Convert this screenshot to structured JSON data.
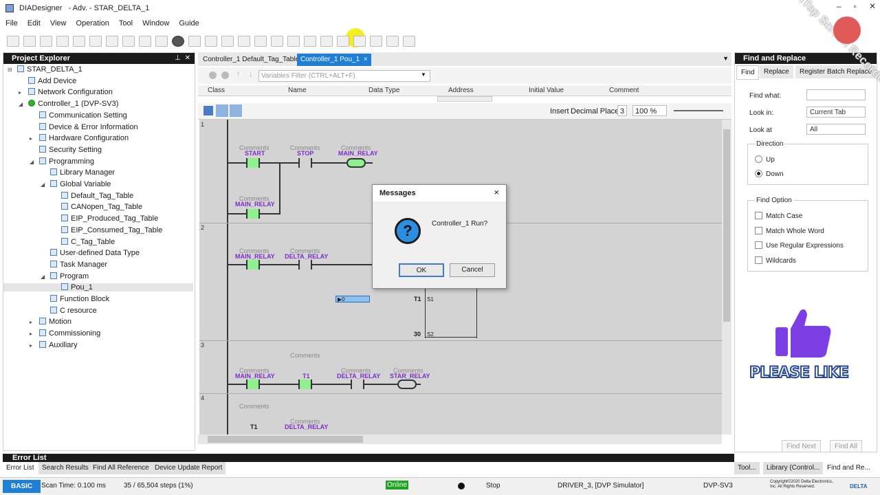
{
  "app": {
    "title": "DIADesigner",
    "subtitle": "- Adv. - STAR_DELTA_1"
  },
  "menu": [
    "File",
    "Edit",
    "View",
    "Operation",
    "Tool",
    "Window",
    "Guide"
  ],
  "explorer": {
    "title": "Project Explorer",
    "items": [
      {
        "label": "STAR_DELTA_1",
        "exp": "⊟"
      },
      {
        "label": "Add Device",
        "exp": ""
      },
      {
        "label": "Network Configuration",
        "exp": "▸"
      },
      {
        "label": "Controller_1 (DVP-SV3)",
        "exp": "◢"
      },
      {
        "label": "Communication Setting",
        "exp": ""
      },
      {
        "label": "Device & Error Information",
        "exp": ""
      },
      {
        "label": "Hardware Configuration",
        "exp": "▸"
      },
      {
        "label": "Security Setting",
        "exp": ""
      },
      {
        "label": "Programming",
        "exp": "◢"
      },
      {
        "label": "Library Manager",
        "exp": ""
      },
      {
        "label": "Global Variable",
        "exp": "◢"
      },
      {
        "label": "Default_Tag_Table",
        "exp": ""
      },
      {
        "label": "CANopen_Tag_Table",
        "exp": ""
      },
      {
        "label": "EIP_Produced_Tag_Table",
        "exp": ""
      },
      {
        "label": "EIP_Consumed_Tag_Table",
        "exp": ""
      },
      {
        "label": "C_Tag_Table",
        "exp": ""
      },
      {
        "label": "User-defined Data Type",
        "exp": ""
      },
      {
        "label": "Task Manager",
        "exp": ""
      },
      {
        "label": "Program",
        "exp": "◢"
      },
      {
        "label": "Pou_1",
        "exp": ""
      },
      {
        "label": "Function Block",
        "exp": ""
      },
      {
        "label": "C resource",
        "exp": ""
      },
      {
        "label": "Motion",
        "exp": "▸"
      },
      {
        "label": "Commissioning",
        "exp": "▸"
      },
      {
        "label": "Auxiliary",
        "exp": "▸"
      }
    ]
  },
  "editor_tabs": [
    {
      "label": "Controller_1 Default_Tag_Table"
    },
    {
      "label": "Controller_1 Pou_1",
      "close": "×"
    }
  ],
  "vars": {
    "filter_placeholder": "Variables Filter (CTRL+ALT+F)",
    "columns": [
      "Class",
      "Name",
      "Data Type",
      "Address",
      "Initial Value",
      "Comment"
    ]
  },
  "ladder_toolbar": {
    "insert": "Insert",
    "decimal_label": "Decimal Place:",
    "decimal_value": "3",
    "zoom": "100 %"
  },
  "ladder": {
    "comment": "Comments",
    "r1": {
      "num": "1",
      "c1": "START",
      "c2": "STOP",
      "coil": "MAIN_RELAY",
      "c3": "MAIN_RELAY"
    },
    "r2": {
      "num": "2",
      "c1": "MAIN_RELAY",
      "c2": "DELTA_RELAY",
      "input": "▶0",
      "t1": "T1",
      "s1": "S1",
      "t30": "30",
      "s2": "S2"
    },
    "r3": {
      "num": "3",
      "c1": "MAIN_RELAY",
      "c2": "T1",
      "c3": "DELTA_RELAY",
      "coil": "STAR_RELAY"
    },
    "r4": {
      "num": "4",
      "c1": "T1",
      "coil": "DELTA_RELAY"
    }
  },
  "dialog": {
    "title": "Messages",
    "close": "×",
    "message": "Controller_1 Run?",
    "ok": "OK",
    "cancel": "Cancel",
    "icon": "?"
  },
  "find": {
    "title": "Find and Replace",
    "tabs": [
      "Find",
      "Replace",
      "Register Batch Replace"
    ],
    "find_what": "Find what:",
    "look_in": "Look in:",
    "look_in_value": "Current Tab",
    "look_at": "Look at",
    "look_at_value": "All",
    "direction": "Direction",
    "up": "Up",
    "down": "Down",
    "find_option": "Find Option",
    "options": [
      "Match Case",
      "Match Whole Word",
      "Use Regular Expressions",
      "Wildcards"
    ],
    "find_next": "Find Next",
    "find_all": "Find All"
  },
  "error_list_title": "Error List",
  "bottom_tabs": [
    "Error List",
    "Search Results",
    "Find All Reference",
    "Device Update Report"
  ],
  "right_bottom_tabs": [
    "Tool...",
    "Library (Control...",
    "Find and Re..."
  ],
  "status": {
    "mode": "BASIC",
    "scan": "Scan Time: 0.100 ms",
    "steps": "35 / 65,504 steps (1%)",
    "online": "Online",
    "stop": "Stop",
    "driver": "DRIVER_3, [DVP Simulator]",
    "model": "DVP-SV3",
    "copyright": "Copyright©2020 Delta Electronics, Inc. All Rights Reserved.",
    "brand": "DELTA"
  },
  "overlay": {
    "watermark": "iTop Screen Recorder",
    "please": "PLEASE LIKE"
  },
  "colors": {
    "accent": "#1f7fd4",
    "contact": "#8ef08e",
    "varname": "#7d2ec9",
    "online": "#1ea51e",
    "like": "#7b3fe4"
  }
}
